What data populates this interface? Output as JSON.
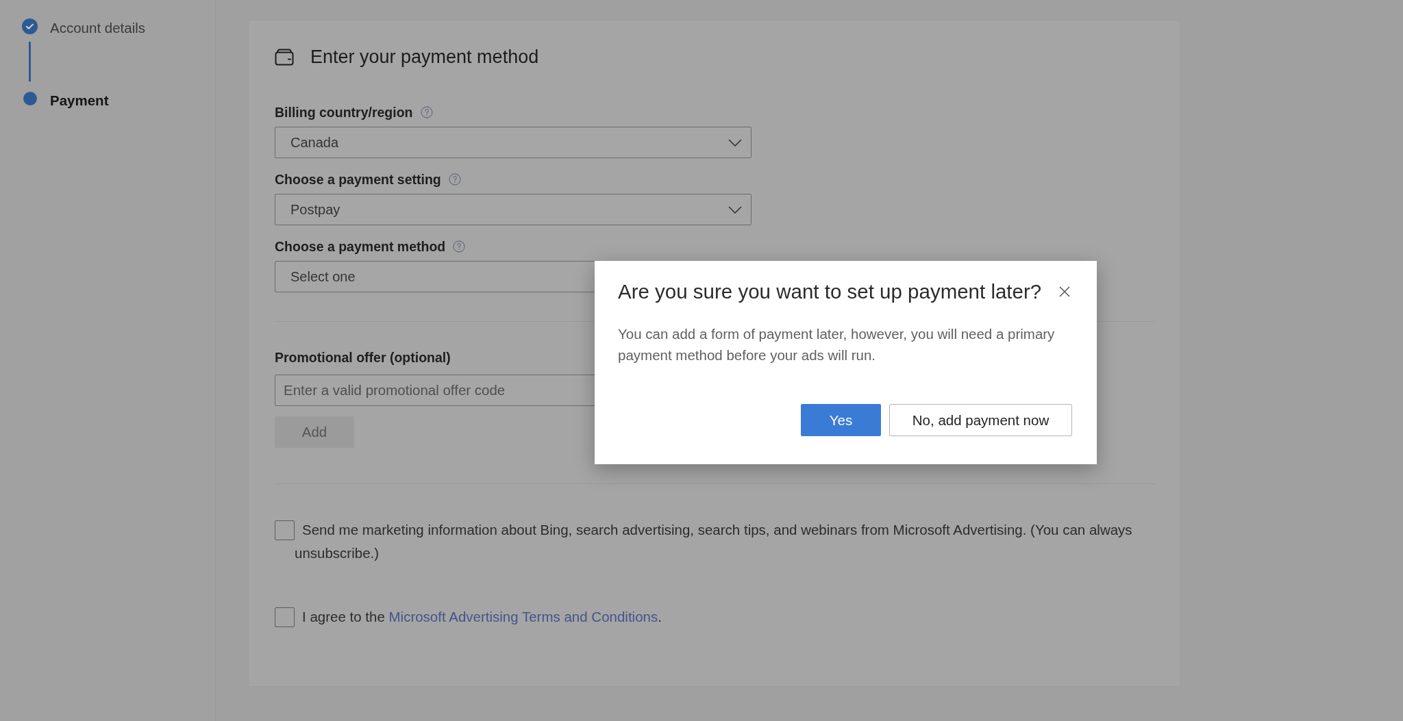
{
  "sidebar": {
    "steps": [
      {
        "label": "Account details",
        "completed": true,
        "selected": false
      },
      {
        "label": "Payment",
        "completed": false,
        "selected": true
      }
    ]
  },
  "form": {
    "title": "Enter your payment method",
    "fields": [
      {
        "label": "Billing country/region",
        "help": true,
        "value": "Canada"
      },
      {
        "label": "Choose a payment setting",
        "help": true,
        "value": "Postpay"
      },
      {
        "label": "Choose a payment method",
        "help": true,
        "value": "Select one"
      }
    ],
    "promo": {
      "label": "Promotional offer (optional)",
      "placeholder": "Enter a valid promotional offer code",
      "button": {
        "label": "Add",
        "disabled": true
      }
    },
    "checkboxes": [
      {
        "text": "Send me marketing information about Bing, search advertising, search tips, and webinars from Microsoft Advertising. (You can always unsubscribe.)",
        "checked": false
      },
      {
        "text": "I agree to the ",
        "link": "Microsoft Advertising Terms and Conditions",
        "text_after": ".",
        "checked": false
      }
    ]
  },
  "dialog": {
    "title": "Are you sure you want to set up payment later?",
    "body": "You can add a form of payment later, however, you will need a primary payment method before your ads will run.",
    "buttons": [
      {
        "label": "Yes",
        "kind": "primary"
      },
      {
        "label": "No, add payment now",
        "kind": "secondary"
      }
    ]
  }
}
